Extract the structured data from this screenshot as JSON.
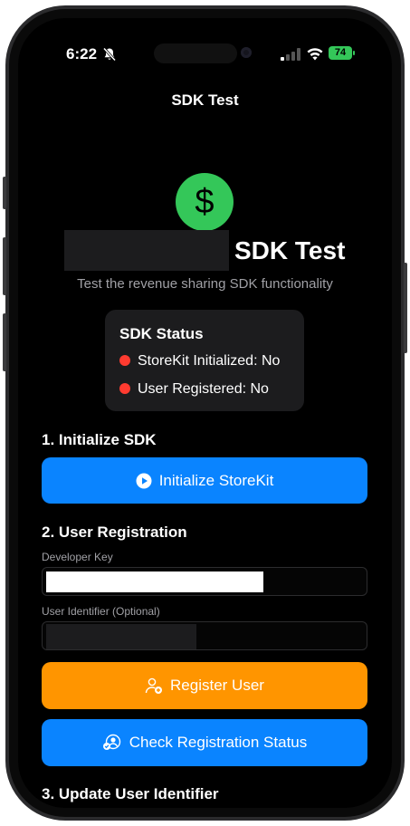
{
  "status_bar": {
    "time": "6:22",
    "battery": "74"
  },
  "nav": {
    "title": "SDK Test"
  },
  "header": {
    "logo_symbol": "$",
    "title": "SDK Test",
    "subtitle": "Test the revenue sharing SDK functionality"
  },
  "sdk_status": {
    "title": "SDK Status",
    "storekit": "StoreKit Initialized: No",
    "user_registered": "User Registered: No"
  },
  "section1": {
    "title": "1. Initialize SDK",
    "button": "Initialize StoreKit"
  },
  "section2": {
    "title": "2. User Registration",
    "developer_key_label": "Developer Key",
    "user_identifier_label": "User Identifier (Optional)",
    "register_button": "Register User",
    "check_button": "Check Registration Status"
  },
  "section3": {
    "title": "3. Update User Identifier"
  },
  "colors": {
    "accent_blue": "#0a84ff",
    "accent_orange": "#ff9500",
    "success_green": "#34c759",
    "status_red": "#ff3b30"
  },
  "icons": [
    "bell-slash-icon",
    "cellular-signal-icon",
    "wifi-icon",
    "dollar-sign-icon",
    "play-circle-icon",
    "person-add-icon",
    "person-check-icon"
  ]
}
